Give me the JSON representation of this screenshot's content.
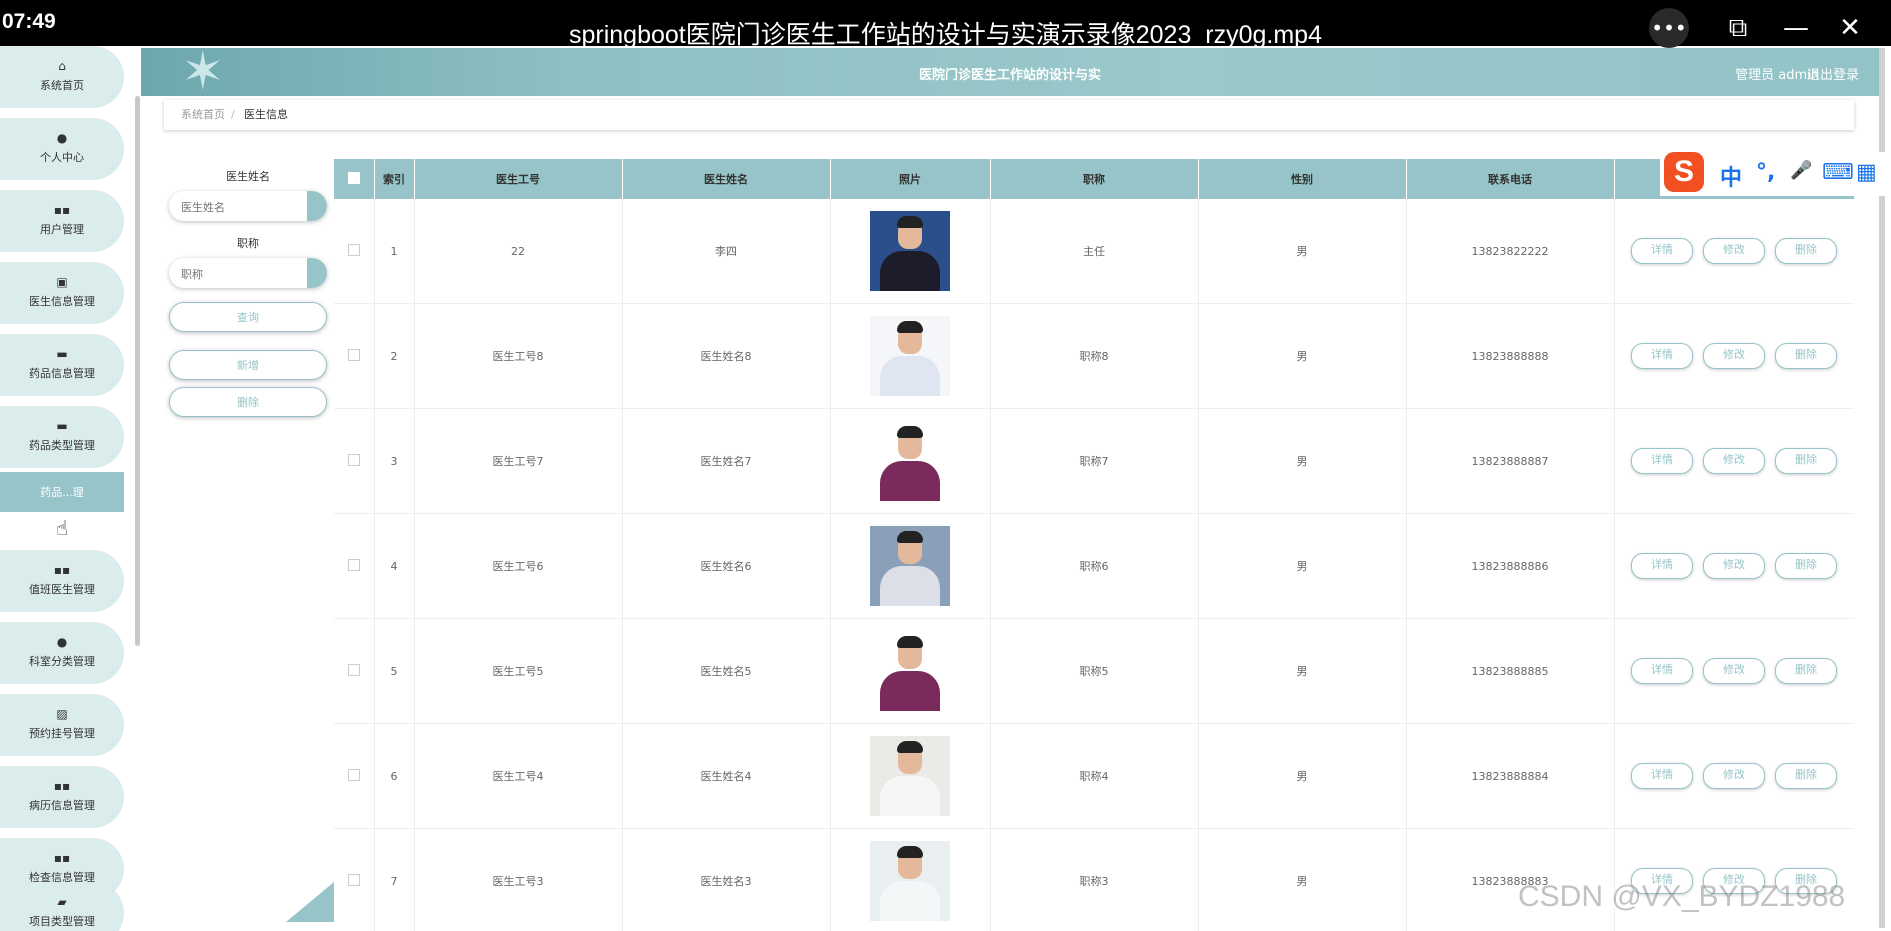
{
  "player": {
    "time": "07:49",
    "title": "springboot医院门诊医生工作站的设计与实演示录像2023_rzy0g.mp4",
    "more_glyph": "•••",
    "mini_glyph": "⧉",
    "minimize_glyph": "—",
    "close_glyph": "✕"
  },
  "sidebar": {
    "items": [
      {
        "label": "系统首页",
        "icon": "home-icon",
        "glyph": "⌂"
      },
      {
        "label": "个人中心",
        "icon": "user-icon",
        "glyph": "●"
      },
      {
        "label": "用户管理",
        "icon": "grid-icon",
        "glyph": "▪▪"
      },
      {
        "label": "医生信息管理",
        "icon": "clipboard-icon",
        "glyph": "▣"
      },
      {
        "label": "药品信息管理",
        "icon": "monitor-icon",
        "glyph": "▬"
      },
      {
        "label": "药品类型管理",
        "icon": "print-icon",
        "glyph": "▬"
      },
      {
        "label": "药品...理",
        "icon": "",
        "glyph": ""
      },
      {
        "label": "值班医生管理",
        "icon": "grid-icon",
        "glyph": "▪▪"
      },
      {
        "label": "科室分类管理",
        "icon": "user-icon",
        "glyph": "●"
      },
      {
        "label": "预约挂号管理",
        "icon": "chart-icon",
        "glyph": "▨"
      },
      {
        "label": "病历信息管理",
        "icon": "grid-icon",
        "glyph": "▪▪"
      },
      {
        "label": "检查信息管理",
        "icon": "grid-icon",
        "glyph": "▪▪"
      },
      {
        "label": "项目类型管理",
        "icon": "wallet-icon",
        "glyph": "▰"
      }
    ]
  },
  "header": {
    "title": "医院门诊医生工作站的设计与实",
    "user": "管理员 admin",
    "logout": "退出登录"
  },
  "breadcrumb": {
    "home": "系统首页",
    "separator": "/",
    "current": "医生信息"
  },
  "filter": {
    "name_label": "医生姓名",
    "name_placeholder": "医生姓名",
    "title_label": "职称",
    "title_placeholder": "职称",
    "search_btn": "查询",
    "add_btn": "新增",
    "delete_btn": "删除"
  },
  "table": {
    "columns": [
      "索引",
      "医生工号",
      "医生姓名",
      "照片",
      "职称",
      "性别",
      "联系电话",
      ""
    ],
    "actions": {
      "detail": "详情",
      "edit": "修改",
      "delete": "删除"
    },
    "rows": [
      {
        "index": "1",
        "id": "22",
        "name": "李四",
        "title": "主任",
        "gender": "男",
        "phone": "13823822222",
        "photo_bg": "#2b4f8a",
        "photo_body": "#1c1c2a"
      },
      {
        "index": "2",
        "id": "医生工号8",
        "name": "医生姓名8",
        "title": "职称8",
        "gender": "男",
        "phone": "13823888888",
        "photo_bg": "#f4f6fa",
        "photo_body": "#dfe6f2"
      },
      {
        "index": "3",
        "id": "医生工号7",
        "name": "医生姓名7",
        "title": "职称7",
        "gender": "男",
        "phone": "13823888887",
        "photo_bg": "#ffffff",
        "photo_body": "#7a2b5c"
      },
      {
        "index": "4",
        "id": "医生工号6",
        "name": "医生姓名6",
        "title": "职称6",
        "gender": "男",
        "phone": "13823888886",
        "photo_bg": "#8a9fb8",
        "photo_body": "#dcdfe8"
      },
      {
        "index": "5",
        "id": "医生工号5",
        "name": "医生姓名5",
        "title": "职称5",
        "gender": "男",
        "phone": "13823888885",
        "photo_bg": "#ffffff",
        "photo_body": "#7a2b5c"
      },
      {
        "index": "6",
        "id": "医生工号4",
        "name": "医生姓名4",
        "title": "职称4",
        "gender": "男",
        "phone": "13823888884",
        "photo_bg": "#eceae6",
        "photo_body": "#f6f6f6"
      },
      {
        "index": "7",
        "id": "医生工号3",
        "name": "医生姓名3",
        "title": "职称3",
        "gender": "男",
        "phone": "13823888883",
        "photo_bg": "#e9eef0",
        "photo_body": "#f4f7f7"
      }
    ]
  },
  "ime": {
    "logo": "S",
    "chinese": "中",
    "punct": "°,",
    "mic": "🎤",
    "keyboard": "⌨",
    "apps": "▦"
  },
  "watermark": "CSDN @VX_BYDZ1988",
  "colors": {
    "accent": "#96c4c8",
    "sidebar_bg": "#dbeced"
  }
}
